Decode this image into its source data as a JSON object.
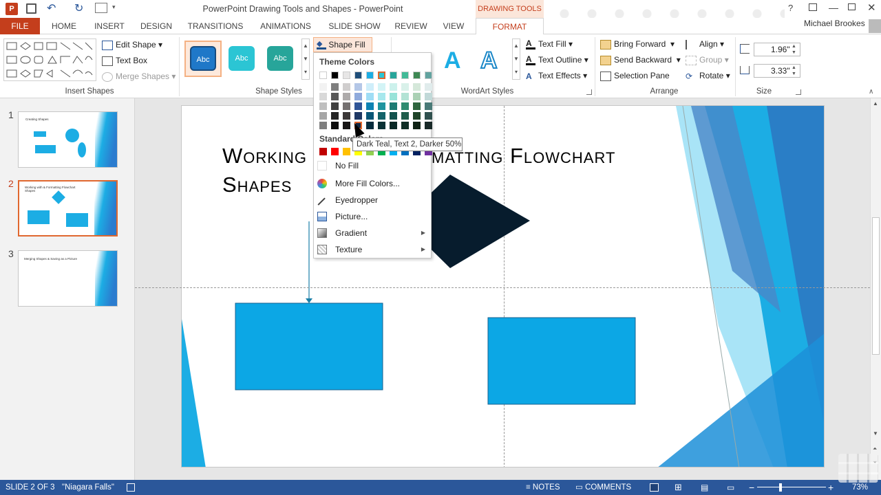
{
  "app": {
    "title": "PowerPoint Drawing Tools and Shapes - PowerPoint",
    "context_tab": "DRAWING TOOLS",
    "user": "Michael Brookes"
  },
  "menu": {
    "tabs": [
      "FILE",
      "HOME",
      "INSERT",
      "DESIGN",
      "TRANSITIONS",
      "ANIMATIONS",
      "SLIDE SHOW",
      "REVIEW",
      "VIEW",
      "FORMAT"
    ]
  },
  "ribbon": {
    "insert_shapes": {
      "label": "Insert Shapes",
      "edit_shape": "Edit Shape",
      "text_box": "Text Box",
      "merge_shapes": "Merge Shapes"
    },
    "shape_styles": {
      "label": "Shape Styles",
      "style1": "Abc",
      "style2": "Abc",
      "style3": "Abc",
      "shape_fill": "Shape Fill"
    },
    "wordart": {
      "label": "WordArt Styles",
      "text_fill": "Text Fill",
      "text_outline": "Text Outline",
      "text_effects": "Text Effects",
      "glyph": "A"
    },
    "arrange": {
      "label": "Arrange",
      "bring_forward": "Bring Forward",
      "send_backward": "Send Backward",
      "selection_pane": "Selection Pane",
      "align": "Align",
      "group": "Group",
      "rotate": "Rotate"
    },
    "size": {
      "label": "Size",
      "height": "1.96\"",
      "width": "3.33\""
    }
  },
  "dropdown": {
    "theme_colors": "Theme Colors",
    "standard_colors": "Standard Colors",
    "no_fill": "No Fill",
    "more_fill": "More Fill Colors...",
    "eyedropper": "Eyedropper",
    "picture": "Picture...",
    "gradient": "Gradient",
    "texture": "Texture",
    "theme_top": [
      "#ffffff",
      "#000000",
      "#e7e6e6",
      "#1f4e79",
      "#1cade4",
      "#2bc5d4",
      "#27a59a",
      "#42ba97",
      "#3e8853",
      "#62a39f"
    ],
    "theme_cols": [
      [
        "#f2f2f2",
        "#d9d9d9",
        "#bfbfbf",
        "#a6a6a6",
        "#7f7f7f"
      ],
      [
        "#7f7f7f",
        "#595959",
        "#404040",
        "#262626",
        "#0d0d0d"
      ],
      [
        "#d0cece",
        "#aeabab",
        "#757171",
        "#3b3838",
        "#171616"
      ],
      [
        "#b4c7e7",
        "#8faadc",
        "#2f5597",
        "#1f3864",
        "#132640"
      ],
      [
        "#cfeefa",
        "#9fddf5",
        "#0d82b3",
        "#095677",
        "#052b3c"
      ],
      [
        "#d3f4f6",
        "#a7e8ed",
        "#1f949f",
        "#14636a",
        "#0a3135"
      ],
      [
        "#ccf1ec",
        "#99e3d9",
        "#1c7b73",
        "#12524d",
        "#092926"
      ],
      [
        "#d9f1ea",
        "#b3e3d5",
        "#2e8b70",
        "#1f5d4b",
        "#0f2e25"
      ],
      [
        "#d5e8da",
        "#abd1b5",
        "#2e653e",
        "#1f4429",
        "#0f2215"
      ],
      [
        "#e0ecec",
        "#c1d9d8",
        "#497a77",
        "#30514f",
        "#182928"
      ]
    ],
    "standard": [
      "#c00000",
      "#ff0000",
      "#ffc000",
      "#ffff00",
      "#92d050",
      "#00b050",
      "#00b0f0",
      "#0070c0",
      "#002060",
      "#7030a0"
    ]
  },
  "tooltip": "Dark Teal, Text 2, Darker 50%",
  "slides": {
    "nums": [
      "1",
      "2",
      "3"
    ],
    "thumb1": "Creating Shapes",
    "thumb2": "Working with & Formatting Flowchart Shapes",
    "thumb3": "Merging Shapes & Saving as a Picture"
  },
  "slide": {
    "title_line1_a": "Working",
    "title_line1_b": "matting Flowchart",
    "title_line2": "Shapes"
  },
  "status": {
    "slide": "SLIDE 2 OF 3",
    "theme": "\"Niagara Falls\"",
    "notes": "NOTES",
    "comments": "COMMENTS",
    "zoom": "73%"
  }
}
